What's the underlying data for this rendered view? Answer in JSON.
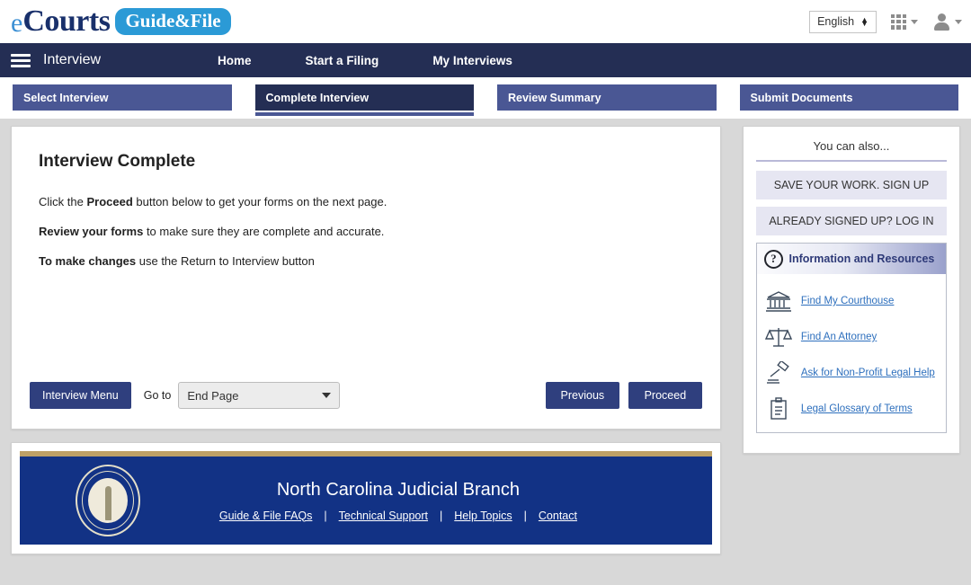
{
  "brand": {
    "logo_e": "e",
    "logo_courts": "Courts",
    "logo_pill": "Guide&File",
    "language": "English",
    "grid_icon": "apps-grid-icon",
    "user_icon": "user-avatar-icon"
  },
  "nav": {
    "menu_icon": "hamburger-menu-icon",
    "title": "Interview",
    "links": [
      {
        "label": "Home"
      },
      {
        "label": "Start a Filing"
      },
      {
        "label": "My Interviews"
      }
    ]
  },
  "steps": [
    {
      "label": "Select Interview",
      "active": false
    },
    {
      "label": "Complete Interview",
      "active": true
    },
    {
      "label": "Review Summary",
      "active": false
    },
    {
      "label": "Submit Documents",
      "active": false
    }
  ],
  "main": {
    "title": "Interview Complete",
    "p1_a": "Click the ",
    "p1_b": "Proceed",
    "p1_c": " button below to get your forms on the next page.",
    "p2_b": "Review your forms",
    "p2_c": " to make sure they are complete and accurate.",
    "p3_b": "To make changes",
    "p3_c": " use the Return to Interview button",
    "interview_menu_label": "Interview Menu",
    "goto_label": "Go to",
    "goto_value": "End Page",
    "previous_label": "Previous",
    "proceed_label": "Proceed"
  },
  "sidebar": {
    "heading": "You can also...",
    "signup_label": "SAVE YOUR WORK. SIGN UP",
    "login_label": "ALREADY SIGNED UP? LOG IN",
    "info_title": "Information and Resources",
    "question_mark": "?",
    "resources": [
      {
        "label": "Find My Courthouse",
        "icon": "courthouse-icon"
      },
      {
        "label": "Find An Attorney",
        "icon": "scales-of-justice-icon"
      },
      {
        "label": "Ask for Non-Profit Legal Help",
        "icon": "gavel-icon"
      },
      {
        "label": "Legal Glossary of Terms",
        "icon": "clipboard-icon"
      }
    ]
  },
  "footer": {
    "title": "North Carolina Judicial Branch",
    "seal": "nc-judicial-seal",
    "links": [
      {
        "label": "Guide & File FAQs"
      },
      {
        "label": "Technical Support"
      },
      {
        "label": "Help Topics"
      },
      {
        "label": "Contact"
      }
    ],
    "separator": "|"
  },
  "colors": {
    "navy": "#242e54",
    "step_inactive": "#4a5794",
    "button_blue": "#2f3f7e",
    "footer_blue": "#123285",
    "footer_gold": "#bda066",
    "link_blue": "#2d6fbd",
    "lavender": "#e6e6f2"
  }
}
